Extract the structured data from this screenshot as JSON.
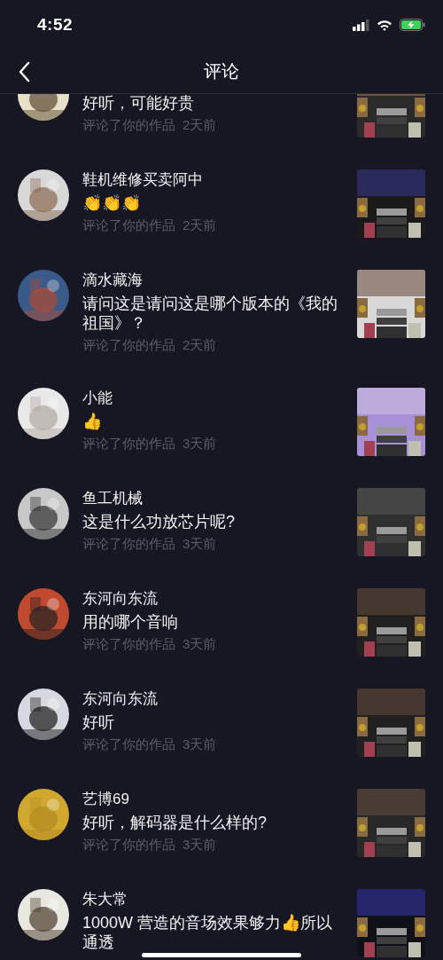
{
  "status_bar": {
    "time": "4:52"
  },
  "nav": {
    "title": "评论"
  },
  "comments": [
    {
      "comment": "好听，可能好贵",
      "action": "评论了你的作品",
      "age": "2天前"
    },
    {
      "name": "鞋机维修买卖阿中",
      "comment": "👏👏👏",
      "action": "评论了你的作品",
      "age": "2天前"
    },
    {
      "name": "滴水藏海",
      "comment": "请问这是请问这是哪个版本的《我的祖国》？",
      "action": "评论了你的作品",
      "age": "2天前"
    },
    {
      "name": "小能",
      "comment": "👍",
      "action": "评论了你的作品",
      "age": "3天前"
    },
    {
      "name": "鱼工机械",
      "comment": "这是什么功放芯片呢?",
      "action": "评论了你的作品",
      "age": "3天前"
    },
    {
      "name": "东河向东流",
      "comment": "用的哪个音响",
      "action": "评论了你的作品",
      "age": "3天前"
    },
    {
      "name": "东河向东流",
      "comment": "好听",
      "action": "评论了你的作品",
      "age": "3天前"
    },
    {
      "name": "艺博69",
      "comment": "好听，解码器是什么样的?",
      "action": "评论了你的作品",
      "age": "3天前"
    },
    {
      "name": "朱大常",
      "comment": "1000W 营造的音场效果够力👍所以通透"
    }
  ]
}
